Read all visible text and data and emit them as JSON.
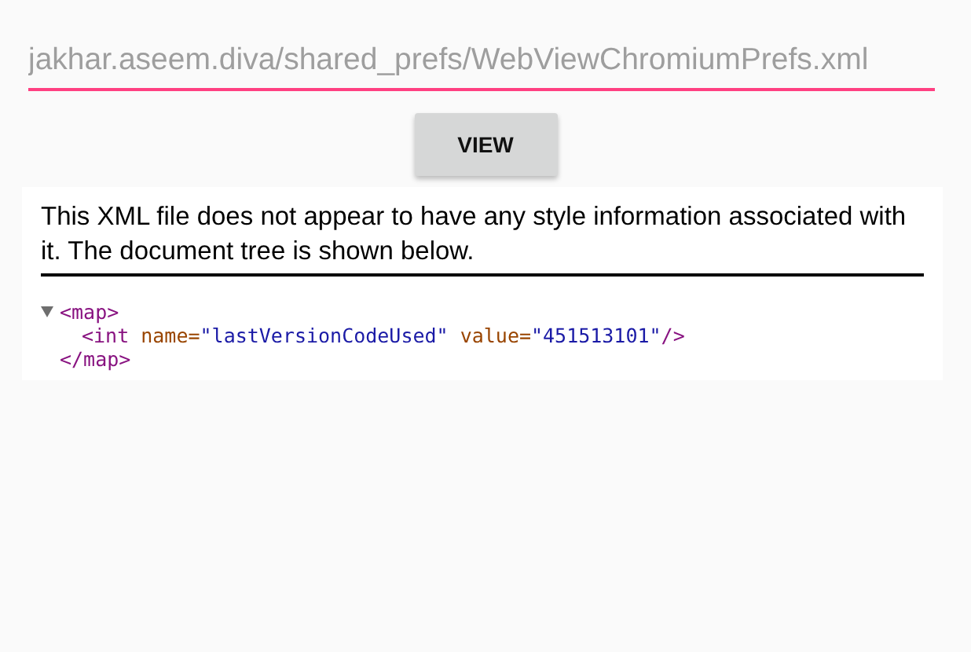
{
  "path_field": {
    "value": "jakhar.aseem.diva/shared_prefs/WebViewChromiumPrefs.xml"
  },
  "view_button": {
    "label": "VIEW"
  },
  "xml_viewer": {
    "notice": "This XML file does not appear to have any style information associated with it. The document tree is shown below.",
    "root": {
      "expanded": true,
      "open": [
        {
          "kind": "tag",
          "text": "<map>"
        }
      ],
      "children": [
        [
          {
            "kind": "tag",
            "text": "<int"
          },
          {
            "kind": "attr_name",
            "text": "name="
          },
          {
            "kind": "attr_value",
            "text": "\"lastVersionCodeUsed\""
          },
          {
            "kind": "attr_name",
            "text": "value="
          },
          {
            "kind": "attr_value",
            "text": "\"451513101\""
          },
          {
            "kind": "tag",
            "text": "/>"
          }
        ]
      ],
      "close": [
        {
          "kind": "tag",
          "text": "</map>"
        }
      ]
    }
  }
}
